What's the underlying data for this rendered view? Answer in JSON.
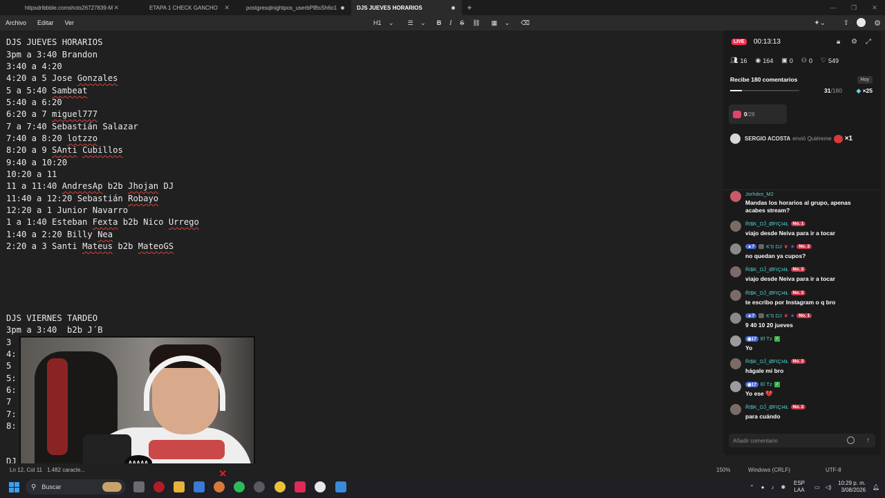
{
  "tabs": [
    {
      "label": "httpsdribbble.comshots26727839-M",
      "active": false
    },
    {
      "label": "ETAPA 1 CHECK GANCHO",
      "active": false
    },
    {
      "label": "postgresqlnightpos_userbPlBsSh6o1",
      "active": false
    },
    {
      "label": "DJS JUEVES HORARIOS",
      "active": true
    }
  ],
  "window_controls": {
    "minimize": "—",
    "maximize": "❐",
    "close": "✕"
  },
  "menu": {
    "items": [
      "Archivo",
      "Editar",
      "Ver"
    ],
    "heading": "H1",
    "format": [
      "B",
      "I",
      "S"
    ]
  },
  "editor": {
    "lines": [
      "DJS JUEVES HORARIOS",
      "3pm a 3:40 Brandon",
      "3:40 a 4:20",
      "4:20 a 5 Jose Gonzales",
      "5 a 5:40 Sambeat",
      "5:40 a 6:20",
      "6:20 a 7 miguel777",
      "7 a 7:40 Sebastián Salazar",
      "7:40 a 8:20 lotzzo",
      "8:20 a 9 SAnti Cubillos",
      "9:40 a 10:20",
      "10:20 a 11",
      "11 a 11:40 AndresAp b2b Jhojan DJ",
      "11:40 a 12:20 Sebastián Robayo",
      "12:20 a 1 Junior Navarro",
      "1 a 1:40 Esteban Fexta b2b Nico Urrego",
      "1:40 a 2:20 Billy Nea",
      "2:20 a 3 Santi Mateus b2b MateoGS"
    ],
    "section2": [
      "DJS VIERNES TARDEO",
      "3pm a 3:40  b2b J´B",
      "3",
      "4:",
      "5",
      "5:",
      "6:",
      "7",
      "7:",
      "8:"
    ],
    "partial_bottom": "DJ"
  },
  "webcam": {
    "logo_text": "AAAAA"
  },
  "statusbar": {
    "position": "Ln 12, Col 11",
    "chars": "1.482 caracte...",
    "zoom": "150%",
    "eol": "Windows (CRLF)",
    "encoding": "UTF-8"
  },
  "taskbar": {
    "search_placeholder": "Buscar",
    "lang_top": "ESP",
    "lang_bottom": "LAA",
    "time": "10:29 p. m.",
    "date": "3/08/2026"
  },
  "live": {
    "badge": "LIVE",
    "timer": "00:13:13",
    "stats": {
      "users": "16",
      "viewers": "164",
      "gifts": "0",
      "shares": "0",
      "likes": "549"
    },
    "goal": {
      "title": "Recibe 180 comentarios",
      "tag": "Hoy",
      "current": "31",
      "total": "/180",
      "progress": 0.17,
      "multiplier": "×25"
    },
    "gift_counter": {
      "current": "0",
      "total": "/28"
    },
    "gift_event": {
      "user": "SERGIO ACOSTA",
      "action": "envió Quiéreme",
      "mult": "×1"
    },
    "chat": [
      {
        "user": "Jorhdxs_M2",
        "badges": [],
        "text": "Mandas los horarios al grupo, apenas acabes stream?"
      },
      {
        "user": "ŘI$K_DĴ_ØFIÇI4Ł",
        "badges": [
          "No. 1"
        ],
        "text": "viajo desde Neiva para ir a tocar"
      },
      {
        "user": "K'S DJ",
        "level": "7",
        "badges": [
          "No. 2"
        ],
        "text": "no quedan ya cupos?"
      },
      {
        "user": "ŘI$K_DĴ_ØFIÇI4Ł",
        "badges": [
          "No. 2"
        ],
        "text": "viajo desde Neiva para ir a tocar"
      },
      {
        "user": "ŘI$K_DĴ_ØFIÇI4Ł",
        "badges": [
          "No. 2"
        ],
        "text": "te escribo por Instagram o q bro"
      },
      {
        "user": "K'S DJ",
        "level": "7",
        "badges": [
          "No. 1"
        ],
        "text": "9 40 10 20 jueves"
      },
      {
        "user": "El Tz",
        "level": "17",
        "badges": [],
        "text": "Yo"
      },
      {
        "user": "ŘI$K_DĴ_ØFIÇI4Ł",
        "badges": [
          "No. 2"
        ],
        "text": "hágale mi bro"
      },
      {
        "user": "El Tz",
        "level": "17",
        "badges": [],
        "text": "Yo ese 💔"
      },
      {
        "user": "ŘI$K_DĴ_ØFIÇI4Ł",
        "badges": [
          "No. 2"
        ],
        "text": "para cuándo"
      }
    ],
    "comment_placeholder": "Añadir comentario"
  },
  "colors": {
    "accent_live": "#fe2c55",
    "chat_user": "#50d2d2",
    "badge_no": "#c8374b",
    "badge_level": "#4a68d8"
  }
}
